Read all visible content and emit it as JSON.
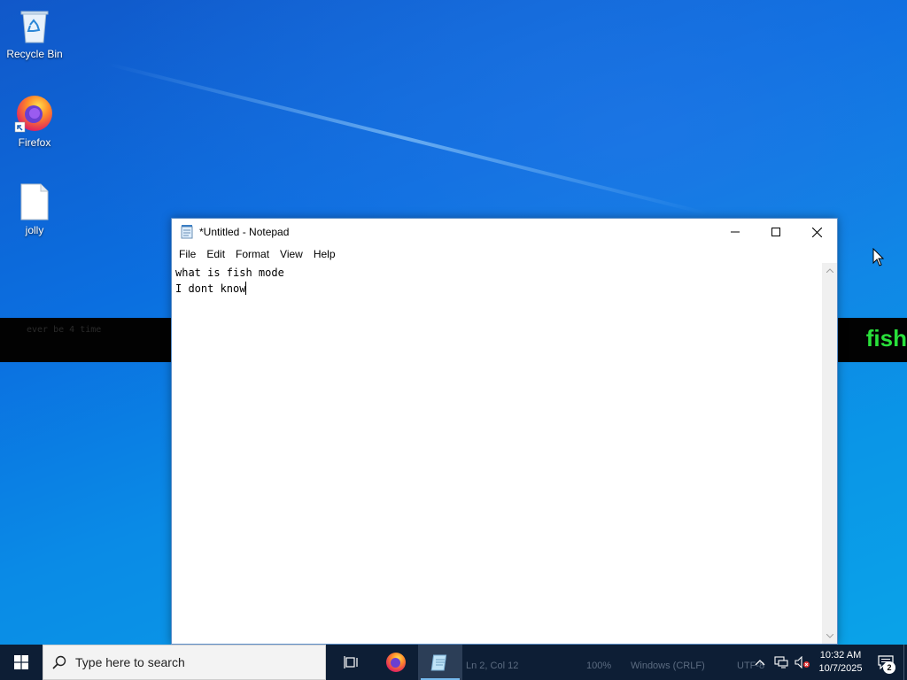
{
  "desktop": {
    "icons": [
      {
        "label": "Recycle Bin",
        "icon": "recycle-bin-icon"
      },
      {
        "label": "Firefox",
        "icon": "firefox-icon"
      },
      {
        "label": "jolly",
        "icon": "text-file-icon"
      }
    ],
    "banner": {
      "left_text": "ever be 4 time",
      "right_text": "fish"
    }
  },
  "notepad": {
    "title": "*Untitled - Notepad",
    "menu": [
      "File",
      "Edit",
      "Format",
      "View",
      "Help"
    ],
    "content_lines": [
      "what is fish mode",
      "I dont know"
    ],
    "controls": {
      "minimize": "minimize-icon",
      "maximize": "maximize-icon",
      "close": "close-icon"
    }
  },
  "taskbar": {
    "search_placeholder": "Type here to search",
    "apps": [
      "task-view-icon",
      "firefox-icon",
      "notepad-icon"
    ],
    "statusbar_ghost": {
      "position": "Ln 2, Col 12",
      "zoom": "100%",
      "line_ending": "Windows (CRLF)",
      "encoding": "UTF-8"
    }
  },
  "tray": {
    "time": "10:32 AM",
    "date": "10/7/2025",
    "notification_count": "2",
    "icons": [
      "chevron-up-icon",
      "network-icon",
      "volume-muted-icon"
    ]
  },
  "colors": {
    "banner_text": "#29e03a",
    "taskbar": "#0d1e35",
    "accent": "#76b9ed"
  }
}
